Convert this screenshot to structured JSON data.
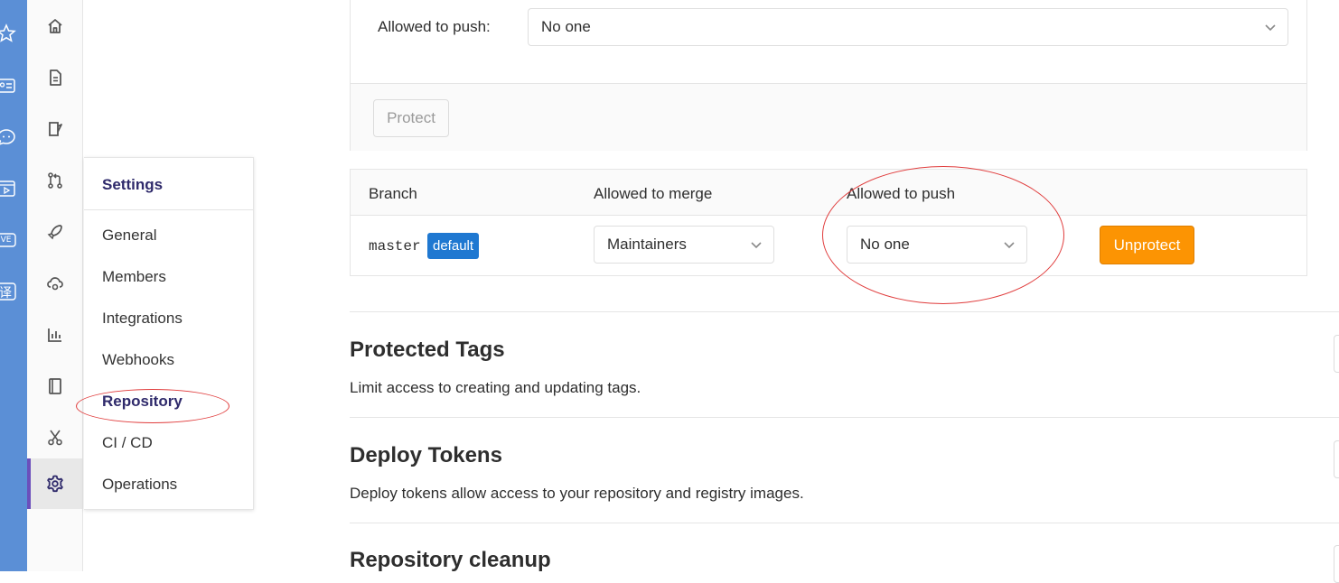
{
  "os_rail": {
    "icons": [
      "star-icon",
      "contact-card-icon",
      "chat-bubble-icon",
      "video-play-icon",
      "live-icon",
      "translate-icon"
    ],
    "live_label": "IVE",
    "translate_char": "译"
  },
  "nav_rail": {
    "items": [
      "home-icon",
      "file-icon",
      "issues-icon",
      "merge-request-icon",
      "rocket-icon",
      "cloud-gear-icon",
      "chart-icon",
      "book-icon",
      "scissors-icon",
      "settings-gear-icon"
    ],
    "active": "settings-gear-icon",
    "accent_color": "#6b4fbb"
  },
  "settings_menu": {
    "title": "Settings",
    "items": [
      {
        "label": "General"
      },
      {
        "label": "Members"
      },
      {
        "label": "Integrations"
      },
      {
        "label": "Webhooks"
      },
      {
        "label": "Repository",
        "active": true
      },
      {
        "label": "CI / CD"
      },
      {
        "label": "Operations"
      }
    ]
  },
  "protect_form": {
    "allowed_to_push_label": "Allowed to push:",
    "allowed_to_push_value": "No one",
    "protect_button": "Protect"
  },
  "protected_branches": {
    "columns": [
      "Branch",
      "Allowed to merge",
      "Allowed to push"
    ],
    "rows": [
      {
        "branch": "master",
        "badge": "default",
        "allowed_to_merge": "Maintainers",
        "allowed_to_push": "No one",
        "action": "Unprotect"
      }
    ]
  },
  "sections": [
    {
      "title": "Protected Tags",
      "description": "Limit access to creating and updating tags."
    },
    {
      "title": "Deploy Tokens",
      "description": "Deploy tokens allow access to your repository and registry images."
    },
    {
      "title": "Repository cleanup",
      "description": ""
    }
  ],
  "colors": {
    "os_rail": "#5b8fd6",
    "badge_blue": "#1f78d1",
    "unprotect_orange": "#fc9403",
    "annotation_red": "#e03c3c",
    "settings_title": "#2f2a6b"
  }
}
